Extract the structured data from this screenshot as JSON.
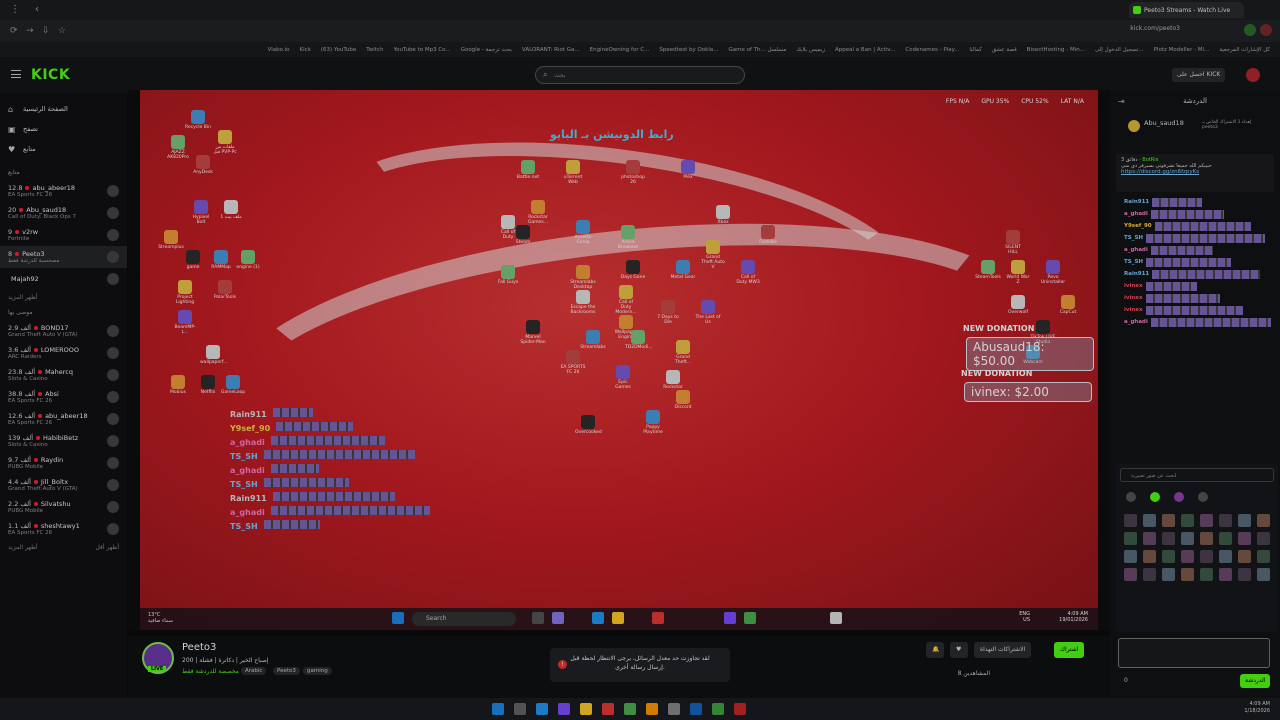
{
  "browser": {
    "tab_title": "Peeto3 Streams - Watch Live",
    "url": "kick.com/peeto3",
    "bookmarks": [
      "كل الإشارات المرجعية",
      "Plotz Modeller - Mi...",
      "تسجيل الدخول إلى...",
      "BisectHosting - Min...",
      "قصة عشق",
      "كمالنا",
      "Codenames - Play...",
      "Appeal a Ban | Activ...",
      "زيميس بلابك",
      "Game of Th... مسلسل",
      "Speedtest by Ookla...",
      "EngineOwning for C...",
      "VALORANT: Riot Ga...",
      "Google - بحث ترجمة",
      "YouTube to Mp3 Co...",
      "Twitch",
      "(63) YouTube",
      "Kick",
      "Vlabo.io"
    ]
  },
  "header": {
    "logo": "KICK",
    "search_placeholder": "بحث",
    "get_kick": "احصل على KICK"
  },
  "sidebar": {
    "nav": [
      {
        "label": "الصفحة الرئيسية",
        "icon": "home-icon"
      },
      {
        "label": "تصفح",
        "icon": "browse-icon"
      },
      {
        "label": "متابع",
        "icon": "heart-icon"
      }
    ],
    "following_header": "متابع",
    "following": [
      {
        "name": "abu_abeer18",
        "count": "12.8",
        "category": "EA Sports FC 26"
      },
      {
        "name": "Abu_saud18",
        "count": "20",
        "category": "Call of Duty: Black Ops 7"
      },
      {
        "name": "v2rw",
        "count": "9",
        "category": "Fortnite"
      },
      {
        "name": "Peeto3",
        "count": "8",
        "category": "مصحسبة للدرشة فقط"
      },
      {
        "name": "Majah92",
        "count": "",
        "category": ""
      }
    ],
    "show_more_1": "أظهر المزيد",
    "recommended_header": "موصى بها",
    "recommended": [
      {
        "name": "BOND17",
        "count": "2.9 ألف",
        "category": "Grand Theft Auto V (GTA)"
      },
      {
        "name": "LOMEROOO",
        "count": "3.6 ألف",
        "category": "ARC Raiders"
      },
      {
        "name": "Mahercq",
        "count": "23.8 ألف",
        "category": "Slots & Casino"
      },
      {
        "name": "Absi",
        "count": "38.8 ألف",
        "category": "EA Sports FC 26"
      },
      {
        "name": "abu_abeer18",
        "count": "12.6 ألف",
        "category": "EA Sports FC 26"
      },
      {
        "name": "HabibiBetz",
        "count": "139 ألف",
        "category": "Slots & Casino"
      },
      {
        "name": "Raydin",
        "count": "9.7 ألف",
        "category": "PUBG Mobile"
      },
      {
        "name": "Jill_Boltx",
        "count": "4.4 ألف",
        "category": "Grand Theft Auto V (GTA)"
      },
      {
        "name": "Silvatshu",
        "count": "2.2 ألف",
        "category": "PUBG Mobile"
      },
      {
        "name": "sheshtawy1",
        "count": "1.1 ألف",
        "category": "EA Sports FC 26"
      }
    ],
    "show_more_2": "أظهر المزيد",
    "show_less": "أظهر أقل"
  },
  "player": {
    "stats": {
      "fps": "FPS N/A",
      "gpu": "GPU 35%",
      "cpu": "CPU 52%",
      "lat": "LAT N/A"
    },
    "donation_title": "رابط الدونيشن بـ البايو",
    "donations": [
      {
        "tag": "NEW DONATION",
        "text": "Abusaud18: $50.00"
      },
      {
        "tag": "NEW DONATION",
        "text": "ivinex: $2.00"
      }
    ],
    "overlay_users": [
      "Rain911",
      "Y9sef_90",
      "a_ghadi",
      "TS_SH",
      "a_ghadi",
      "TS_SH",
      "Rain911",
      "a_ghadi",
      "TS_SH"
    ],
    "desktop_icons": [
      "Recycle Bin",
      "AJAZZ AK820Pro",
      "ملفات من قبل PVP-Pc",
      "AnyDesk",
      "Hypixel Bolt",
      "ملف بيت 1",
      "Streamplus",
      "game",
      "RAMMap",
      "engine (1)",
      "Project Lighting",
      "PolarTools",
      "BeamMP-L...",
      "wallpaperf...",
      "Mobius",
      "Netflix",
      "GameLoop",
      "Battle.net",
      "uTorrent Web",
      "photoshop 26",
      "Plex",
      "Xbox",
      "Rockstar Games...",
      "Steam",
      "Assetto Corsa",
      "Arena Breakout",
      "Grand Theft Auto V",
      "Fortnite",
      "Call of Duty MW3",
      "Call of Duty",
      "Streamlabs Desktop",
      "Days Gone",
      "Metal Gear",
      "Fall Guys",
      "Call of Duty Modern...",
      "7 Days to Die",
      "The Last of Us",
      "Escape the Backrooms",
      "Wallpaper Engine",
      "Marvel Spider-Man",
      "Streamlabs",
      "TD2DModi...",
      "Grand Theft...",
      "EA SPORTS FC 26",
      "Epic Games",
      "Rockstar",
      "Discord",
      "Overcooked",
      "Poppy Playtime",
      "SteamTools",
      "World War Z",
      "SILENT HILL",
      "Revo Uninstaller",
      "Overwolf",
      "CapCut",
      "TikTok LIVE Studio",
      "Webcam"
    ],
    "taskbar": {
      "search": "Search",
      "weather_temp": "13°C",
      "weather_desc": "سماء صافية",
      "lang": "ENG US",
      "time": "4:09 AM",
      "date": "19/01/2026"
    }
  },
  "stream": {
    "name": "Peeto3",
    "live_label": "LIVE",
    "title": "إصباح الخير | دكاترة | فشلة | 200",
    "category": "مخصصة للدردشة فقط",
    "tags": [
      "Arabic",
      "Peeto3",
      "gaming"
    ],
    "follow_label": "اشتراك",
    "subscribe_label": "الاشتراكات التهداة",
    "viewers_label": "8 المشاهدين"
  },
  "toast": {
    "text": "لقد تجاوزت حد معدل الرسائل، يرجى الانتظار لحظة قبل إرسال رسالة أخرى."
  },
  "chat": {
    "header": "الدردشة",
    "pinned": {
      "name": "Abu_saud18",
      "text": "إهداء 1 الاشتراك الخاص بـ peeto3"
    },
    "botrix": {
      "author": "BotRix",
      "time": "3 دقائق",
      "text": "حبيبكم الله جميعا تشرفوني بسيرفر دي سي",
      "link": "https://discord.gg/zn6fzpyKs"
    },
    "messages": [
      {
        "user": "Rain911",
        "color": "#7ec8ff"
      },
      {
        "user": "a_ghadi",
        "color": "#ff7ac8"
      },
      {
        "user": "Y9sef_90",
        "color": "#ffd24a"
      },
      {
        "user": "TS_SH",
        "color": "#7ec8ff"
      },
      {
        "user": "a_ghadi",
        "color": "#ff7ac8"
      },
      {
        "user": "TS_SH",
        "color": "#7ec8ff"
      },
      {
        "user": "Rain911",
        "color": "#7ec8ff"
      },
      {
        "user": "ivinex",
        "color": "#ff4d6a"
      },
      {
        "user": "ivinex",
        "color": "#ff4d6a"
      },
      {
        "user": "ivinex",
        "color": "#ff4d6a"
      },
      {
        "user": "a_ghadi",
        "color": "#ff7ac8"
      }
    ],
    "emote_search_placeholder": "ابحث عن صور تعبيرية",
    "send_label": "الدردشة",
    "count": "0"
  },
  "windows_taskbar": {
    "time": "4:09 AM",
    "date": "1/18/2026"
  }
}
